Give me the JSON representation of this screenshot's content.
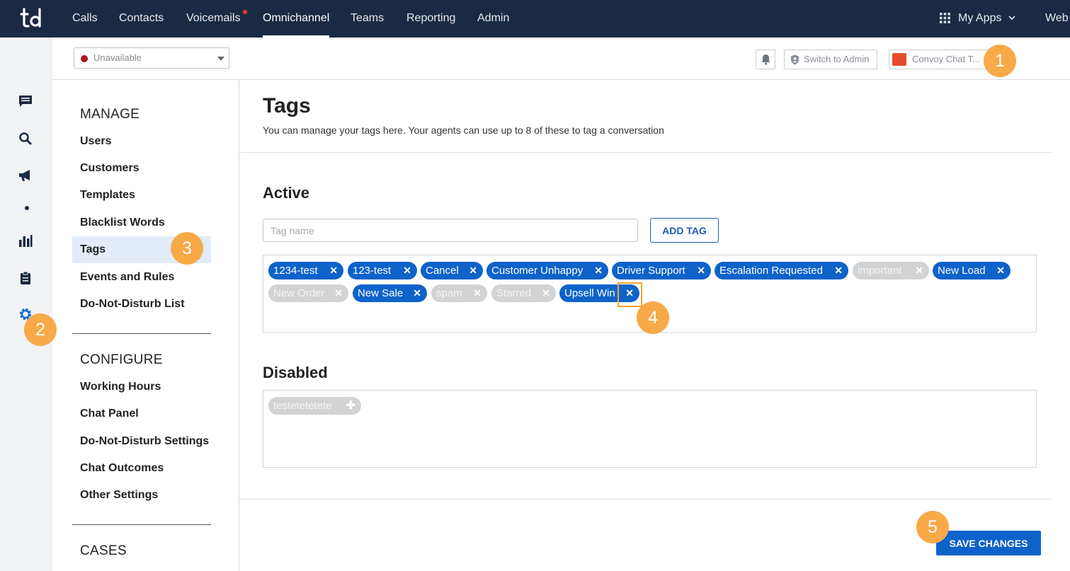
{
  "nav": {
    "items": [
      "Calls",
      "Contacts",
      "Voicemails",
      "Omnichannel",
      "Teams",
      "Reporting",
      "Admin"
    ],
    "my_apps": "My Apps",
    "web": "Web"
  },
  "rail": {
    "icons": [
      "chat-icon",
      "search-icon",
      "megaphone-icon",
      "dot-icon",
      "bar-chart-icon",
      "clipboard-icon",
      "gear-icon"
    ]
  },
  "subheader": {
    "status": "Unavailable",
    "status_color": "#a01818",
    "switch_admin": "Switch to Admin",
    "convoy": "Convoy Chat T..."
  },
  "sidebar": {
    "manage_title": "MANAGE",
    "manage_items": [
      "Users",
      "Customers",
      "Templates",
      "Blacklist Words",
      "Tags",
      "Events and Rules",
      "Do-Not-Disturb List"
    ],
    "configure_title": "CONFIGURE",
    "configure_items": [
      "Working Hours",
      "Chat Panel",
      "Do-Not-Disturb Settings",
      "Chat Outcomes",
      "Other Settings"
    ],
    "cases_title": "CASES"
  },
  "main": {
    "title": "Tags",
    "subtitle": "You can manage your tags here. Your agents can use up to 8 of these to tag a conversation",
    "active_title": "Active",
    "tag_placeholder": "Tag name",
    "add_tag": "ADD TAG",
    "active_tags": [
      {
        "label": "1234-test",
        "enabled": true
      },
      {
        "label": "123-test",
        "enabled": true
      },
      {
        "label": "Cancel",
        "enabled": true
      },
      {
        "label": "Customer Unhappy",
        "enabled": true
      },
      {
        "label": "Driver Support",
        "enabled": true
      },
      {
        "label": "Escalation Requested",
        "enabled": true
      },
      {
        "label": "important",
        "enabled": false
      },
      {
        "label": "New Load",
        "enabled": true
      },
      {
        "label": "New Order",
        "enabled": false
      },
      {
        "label": "New Sale",
        "enabled": true
      },
      {
        "label": "spam",
        "enabled": false
      },
      {
        "label": "Starred",
        "enabled": false
      },
      {
        "label": "Upsell Win",
        "enabled": true
      }
    ],
    "disabled_title": "Disabled",
    "disabled_tags": [
      "testetetetete"
    ],
    "save": "SAVE CHANGES"
  },
  "callouts": [
    "1",
    "2",
    "3",
    "4",
    "5"
  ],
  "colors": {
    "nav_bg": "#1b2a44",
    "accent": "#0d63c9",
    "callout": "#f8a948",
    "active_bg": "#e3ecf8"
  }
}
